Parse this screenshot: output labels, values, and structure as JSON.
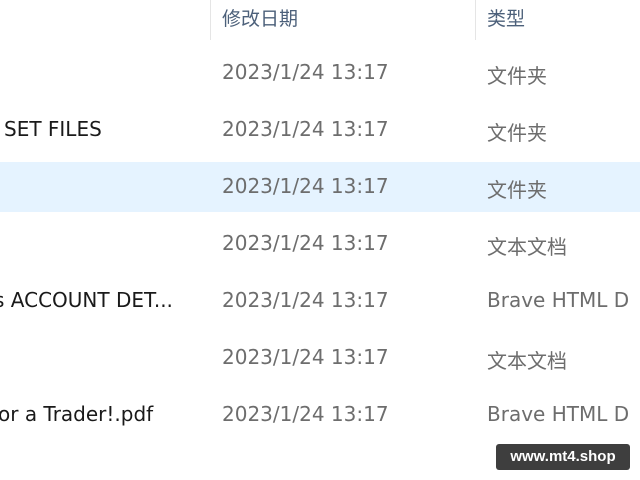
{
  "header": {
    "date_modified": "修改日期",
    "type": "类型"
  },
  "rows": [
    {
      "name": "",
      "date": "2023/1/24 13:17",
      "type": "文件夹",
      "selected": false
    },
    {
      "name": "SET FILES",
      "date": "2023/1/24 13:17",
      "type": "文件夹",
      "selected": false
    },
    {
      "name": "",
      "date": "2023/1/24 13:17",
      "type": "文件夹",
      "selected": true
    },
    {
      "name": "",
      "date": "2023/1/24 13:17",
      "type": "文本文档",
      "selected": false
    },
    {
      "name": "s ACCOUNT DET...",
      "date": "2023/1/24 13:17",
      "type": "Brave HTML D",
      "selected": false
    },
    {
      "name": "",
      "date": "2023/1/24 13:17",
      "type": "文本文档",
      "selected": false
    },
    {
      "name": "or a Trader!.pdf",
      "date": "2023/1/24 13:17",
      "type": "Brave HTML D",
      "selected": false
    }
  ],
  "watermark": "www.mt4.shop"
}
